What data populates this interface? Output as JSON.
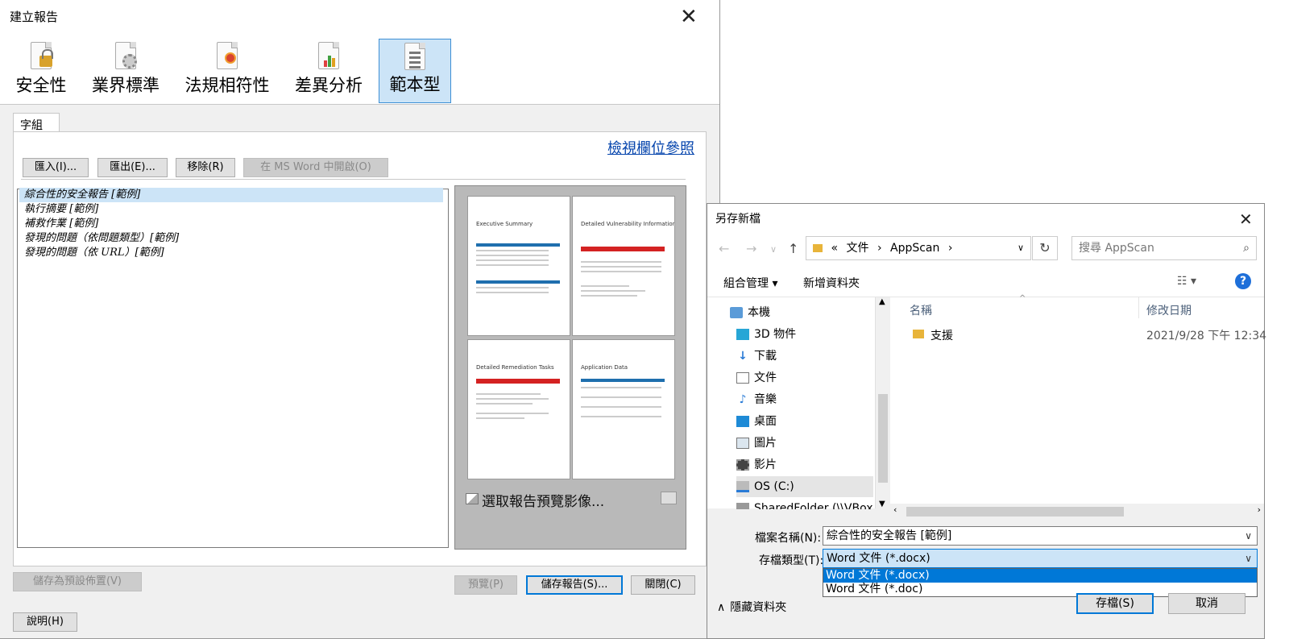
{
  "left_dialog": {
    "title": "建立報告",
    "report_types": [
      {
        "label": "安全性",
        "icon": "lock-report-icon"
      },
      {
        "label": "業界標準",
        "icon": "gear-report-icon"
      },
      {
        "label": "法規相符性",
        "icon": "ribbon-report-icon"
      },
      {
        "label": "差異分析",
        "icon": "chart-report-icon"
      },
      {
        "label": "範本型",
        "icon": "template-report-icon",
        "selected": true
      }
    ],
    "tab_label": "字組",
    "view_field_reference": "檢視欄位參照",
    "buttons": {
      "import": "匯入(I)...",
      "export": "匯出(E)...",
      "remove": "移除(R)",
      "open_in_word": "在 MS Word 中開啟(O)"
    },
    "templates": [
      "綜合性的安全報告 [範例]",
      "執行摘要 [範例]",
      "補救作業 [範例]",
      "發現的問題（依問題類型）[範例]",
      "發現的問題（依 URL）[範例]"
    ],
    "preview_pages": [
      "Executive Summary",
      "Detailed Vulnerability Information",
      "Detailed Remediation Tasks",
      "Application Data"
    ],
    "preview_label": "選取報告預覽影像...",
    "save_default_layout": "儲存為預設佈置(V)",
    "preview_button": "預覽(P)",
    "save_report_button": "儲存報告(S)...",
    "close_button": "關閉(C)",
    "help_button": "說明(H)"
  },
  "right_dialog": {
    "title": "另存新檔",
    "breadcrumb": [
      "«",
      "文件",
      "AppScan"
    ],
    "search_placeholder": "搜尋 AppScan",
    "organize": "組合管理 ▾",
    "new_folder": "新增資料夾",
    "nav_items": [
      {
        "label": "本機",
        "icon": "computer-icon"
      },
      {
        "label": "3D 物件",
        "icon": "cube-icon"
      },
      {
        "label": "下載",
        "icon": "download-icon"
      },
      {
        "label": "文件",
        "icon": "document-icon"
      },
      {
        "label": "音樂",
        "icon": "music-icon"
      },
      {
        "label": "桌面",
        "icon": "desktop-icon"
      },
      {
        "label": "圖片",
        "icon": "picture-icon"
      },
      {
        "label": "影片",
        "icon": "video-icon"
      },
      {
        "label": "OS (C:)",
        "icon": "drive-icon",
        "selected": true
      },
      {
        "label": "SharedFolder (\\\\VBoxSv",
        "icon": "network-drive-icon"
      }
    ],
    "columns": {
      "name": "名稱",
      "modified": "修改日期"
    },
    "files": [
      {
        "name": "支援",
        "modified": "2021/9/28 下午 12:34"
      }
    ],
    "filename_label": "檔案名稱(N):",
    "filename_value": "綜合性的安全報告 [範例]",
    "filetype_label": "存檔類型(T):",
    "filetype_value": "Word 文件 (*.docx)",
    "filetype_options": [
      "Word 文件 (*.docx)",
      "Word 文件 (*.doc)"
    ],
    "hide_folders": "隱藏資料夾",
    "save_button": "存檔(S)",
    "cancel_button": "取消"
  },
  "colors": {
    "accent": "#0078d7",
    "selection": "#cce4f7",
    "link": "#0645ad"
  }
}
